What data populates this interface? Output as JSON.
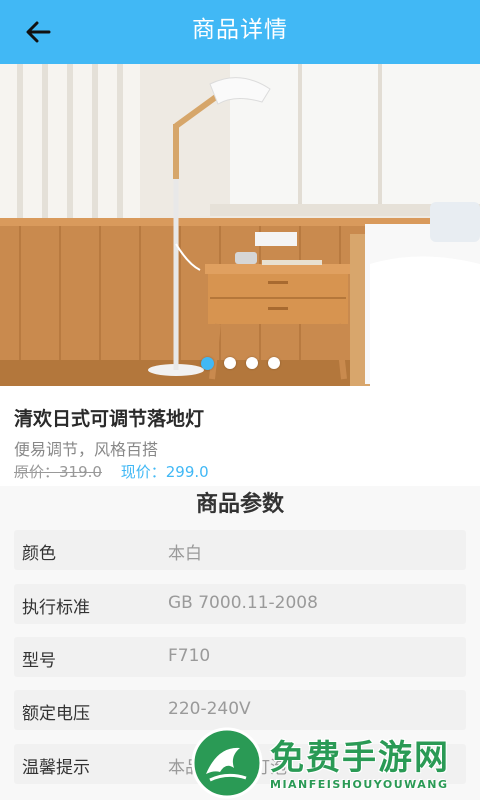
{
  "header": {
    "title": "商品详情",
    "back_icon": "arrow-left-icon"
  },
  "banner": {
    "image_subject": "floor lamp beside wooden nightstand and bed",
    "slide_count": 4,
    "active_index": 0,
    "indicator_color": "#41b8f5"
  },
  "product": {
    "name": "清欢日式可调节落地灯",
    "subtitle": "便易调节，风格百搭",
    "old_price_text": "原价：319.0",
    "current_price_text": "现价：299.0"
  },
  "params": {
    "title": "商品参数",
    "rows": [
      {
        "key": "颜色",
        "value": "本白"
      },
      {
        "key": "执行标准",
        "value": "GB 7000.11-2008"
      },
      {
        "key": "型号",
        "value": "F710"
      },
      {
        "key": "额定电压",
        "value": "220-240V"
      },
      {
        "key": "温馨提示",
        "value": "本品不包含灯泡"
      }
    ]
  },
  "watermark": {
    "text": "免费手游网",
    "sub": "MIANFEISHOUYOUWANG"
  },
  "colors": {
    "accent": "#41b8f5",
    "background": "#f4f4f4"
  }
}
